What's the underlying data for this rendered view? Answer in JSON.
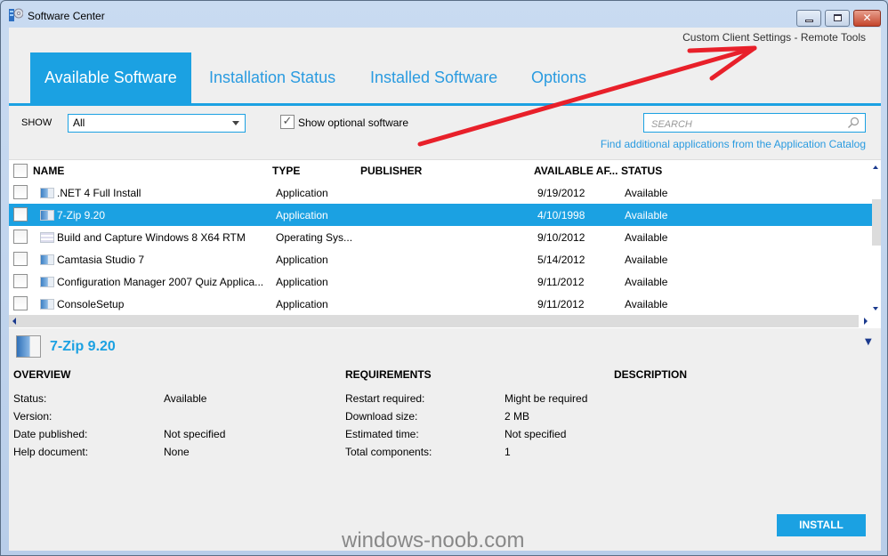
{
  "window": {
    "title": "Software Center",
    "controls": {
      "minimize": "minimize",
      "maximize": "maximize",
      "close": "close"
    }
  },
  "header": {
    "org_label": "Custom Client Settings - Remote Tools"
  },
  "tabs": [
    {
      "label": "Available Software",
      "active": true
    },
    {
      "label": "Installation Status",
      "active": false
    },
    {
      "label": "Installed Software",
      "active": false
    },
    {
      "label": "Options",
      "active": false
    }
  ],
  "toolbar": {
    "show_label": "SHOW",
    "show_value": "All",
    "optional_checked": true,
    "optional_label": "Show optional software",
    "search_placeholder": "SEARCH",
    "catalog_link": "Find additional applications from the Application Catalog"
  },
  "table": {
    "columns": [
      "NAME",
      "TYPE",
      "PUBLISHER",
      "AVAILABLE AF...",
      "STATUS"
    ],
    "rows": [
      {
        "name": ".NET 4 Full Install",
        "type": "Application",
        "publisher": "",
        "available": "9/19/2012",
        "status": "Available",
        "icon": "application-icon",
        "selected": false
      },
      {
        "name": "7-Zip 9.20",
        "type": "Application",
        "publisher": "",
        "available": "4/10/1998",
        "status": "Available",
        "icon": "application-icon",
        "selected": true
      },
      {
        "name": "Build and Capture Windows 8 X64 RTM",
        "type": "Operating Sys...",
        "publisher": "",
        "available": "9/10/2012",
        "status": "Available",
        "icon": "task-sequence-icon",
        "selected": false
      },
      {
        "name": "Camtasia Studio 7",
        "type": "Application",
        "publisher": "",
        "available": "5/14/2012",
        "status": "Available",
        "icon": "application-icon",
        "selected": false
      },
      {
        "name": "Configuration Manager 2007 Quiz Applica...",
        "type": "Application",
        "publisher": "",
        "available": "9/11/2012",
        "status": "Available",
        "icon": "application-icon",
        "selected": false
      },
      {
        "name": "ConsoleSetup",
        "type": "Application",
        "publisher": "",
        "available": "9/11/2012",
        "status": "Available",
        "icon": "application-icon",
        "selected": false
      }
    ]
  },
  "detail": {
    "title": "7-Zip 9.20",
    "overview": {
      "heading": "OVERVIEW",
      "items": [
        {
          "label": "Status:",
          "value": "Available"
        },
        {
          "label": "Version:",
          "value": ""
        },
        {
          "label": "Date published:",
          "value": "Not specified"
        },
        {
          "label": "Help document:",
          "value": "None"
        }
      ]
    },
    "requirements": {
      "heading": "REQUIREMENTS",
      "items": [
        {
          "label": "Restart required:",
          "value": "Might be required"
        },
        {
          "label": "Download size:",
          "value": "2 MB"
        },
        {
          "label": "Estimated time:",
          "value": "Not specified"
        },
        {
          "label": "Total components:",
          "value": "1"
        }
      ]
    },
    "description": {
      "heading": "DESCRIPTION",
      "text": ""
    },
    "install_label": "INSTALL"
  },
  "watermark": "windows-noob.com",
  "colors": {
    "accent": "#1ba1e2",
    "annotation": "#e8202a"
  }
}
